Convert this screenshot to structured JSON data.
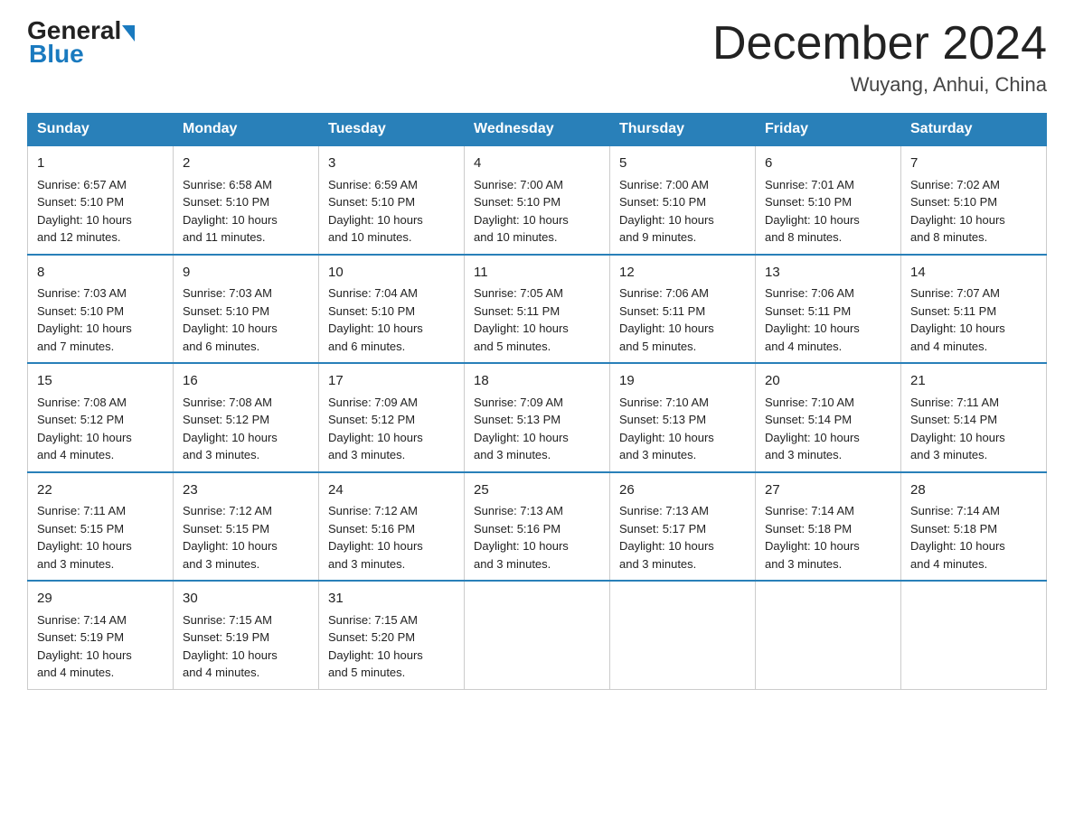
{
  "header": {
    "logo_general": "General",
    "logo_blue": "Blue",
    "month_title": "December 2024",
    "location": "Wuyang, Anhui, China"
  },
  "weekdays": [
    "Sunday",
    "Monday",
    "Tuesday",
    "Wednesday",
    "Thursday",
    "Friday",
    "Saturday"
  ],
  "weeks": [
    [
      {
        "day": "1",
        "sunrise": "6:57 AM",
        "sunset": "5:10 PM",
        "daylight": "10 hours and 12 minutes."
      },
      {
        "day": "2",
        "sunrise": "6:58 AM",
        "sunset": "5:10 PM",
        "daylight": "10 hours and 11 minutes."
      },
      {
        "day": "3",
        "sunrise": "6:59 AM",
        "sunset": "5:10 PM",
        "daylight": "10 hours and 10 minutes."
      },
      {
        "day": "4",
        "sunrise": "7:00 AM",
        "sunset": "5:10 PM",
        "daylight": "10 hours and 10 minutes."
      },
      {
        "day": "5",
        "sunrise": "7:00 AM",
        "sunset": "5:10 PM",
        "daylight": "10 hours and 9 minutes."
      },
      {
        "day": "6",
        "sunrise": "7:01 AM",
        "sunset": "5:10 PM",
        "daylight": "10 hours and 8 minutes."
      },
      {
        "day": "7",
        "sunrise": "7:02 AM",
        "sunset": "5:10 PM",
        "daylight": "10 hours and 8 minutes."
      }
    ],
    [
      {
        "day": "8",
        "sunrise": "7:03 AM",
        "sunset": "5:10 PM",
        "daylight": "10 hours and 7 minutes."
      },
      {
        "day": "9",
        "sunrise": "7:03 AM",
        "sunset": "5:10 PM",
        "daylight": "10 hours and 6 minutes."
      },
      {
        "day": "10",
        "sunrise": "7:04 AM",
        "sunset": "5:10 PM",
        "daylight": "10 hours and 6 minutes."
      },
      {
        "day": "11",
        "sunrise": "7:05 AM",
        "sunset": "5:11 PM",
        "daylight": "10 hours and 5 minutes."
      },
      {
        "day": "12",
        "sunrise": "7:06 AM",
        "sunset": "5:11 PM",
        "daylight": "10 hours and 5 minutes."
      },
      {
        "day": "13",
        "sunrise": "7:06 AM",
        "sunset": "5:11 PM",
        "daylight": "10 hours and 4 minutes."
      },
      {
        "day": "14",
        "sunrise": "7:07 AM",
        "sunset": "5:11 PM",
        "daylight": "10 hours and 4 minutes."
      }
    ],
    [
      {
        "day": "15",
        "sunrise": "7:08 AM",
        "sunset": "5:12 PM",
        "daylight": "10 hours and 4 minutes."
      },
      {
        "day": "16",
        "sunrise": "7:08 AM",
        "sunset": "5:12 PM",
        "daylight": "10 hours and 3 minutes."
      },
      {
        "day": "17",
        "sunrise": "7:09 AM",
        "sunset": "5:12 PM",
        "daylight": "10 hours and 3 minutes."
      },
      {
        "day": "18",
        "sunrise": "7:09 AM",
        "sunset": "5:13 PM",
        "daylight": "10 hours and 3 minutes."
      },
      {
        "day": "19",
        "sunrise": "7:10 AM",
        "sunset": "5:13 PM",
        "daylight": "10 hours and 3 minutes."
      },
      {
        "day": "20",
        "sunrise": "7:10 AM",
        "sunset": "5:14 PM",
        "daylight": "10 hours and 3 minutes."
      },
      {
        "day": "21",
        "sunrise": "7:11 AM",
        "sunset": "5:14 PM",
        "daylight": "10 hours and 3 minutes."
      }
    ],
    [
      {
        "day": "22",
        "sunrise": "7:11 AM",
        "sunset": "5:15 PM",
        "daylight": "10 hours and 3 minutes."
      },
      {
        "day": "23",
        "sunrise": "7:12 AM",
        "sunset": "5:15 PM",
        "daylight": "10 hours and 3 minutes."
      },
      {
        "day": "24",
        "sunrise": "7:12 AM",
        "sunset": "5:16 PM",
        "daylight": "10 hours and 3 minutes."
      },
      {
        "day": "25",
        "sunrise": "7:13 AM",
        "sunset": "5:16 PM",
        "daylight": "10 hours and 3 minutes."
      },
      {
        "day": "26",
        "sunrise": "7:13 AM",
        "sunset": "5:17 PM",
        "daylight": "10 hours and 3 minutes."
      },
      {
        "day": "27",
        "sunrise": "7:14 AM",
        "sunset": "5:18 PM",
        "daylight": "10 hours and 3 minutes."
      },
      {
        "day": "28",
        "sunrise": "7:14 AM",
        "sunset": "5:18 PM",
        "daylight": "10 hours and 4 minutes."
      }
    ],
    [
      {
        "day": "29",
        "sunrise": "7:14 AM",
        "sunset": "5:19 PM",
        "daylight": "10 hours and 4 minutes."
      },
      {
        "day": "30",
        "sunrise": "7:15 AM",
        "sunset": "5:19 PM",
        "daylight": "10 hours and 4 minutes."
      },
      {
        "day": "31",
        "sunrise": "7:15 AM",
        "sunset": "5:20 PM",
        "daylight": "10 hours and 5 minutes."
      },
      null,
      null,
      null,
      null
    ]
  ],
  "labels": {
    "sunrise": "Sunrise:",
    "sunset": "Sunset:",
    "daylight": "Daylight:"
  }
}
